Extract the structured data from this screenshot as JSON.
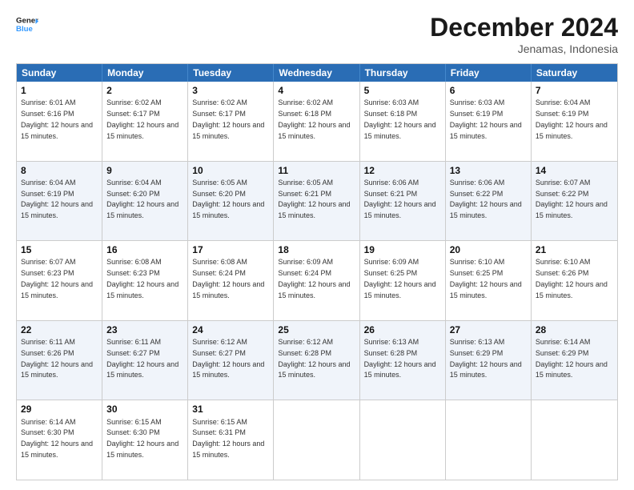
{
  "header": {
    "logo_general": "General",
    "logo_blue": "Blue",
    "month_title": "December 2024",
    "location": "Jenamas, Indonesia"
  },
  "days_of_week": [
    "Sunday",
    "Monday",
    "Tuesday",
    "Wednesday",
    "Thursday",
    "Friday",
    "Saturday"
  ],
  "weeks": [
    [
      {
        "day": 1,
        "sunrise": "6:01 AM",
        "sunset": "6:16 PM",
        "daylight": "12 hours and 15 minutes."
      },
      {
        "day": 2,
        "sunrise": "6:02 AM",
        "sunset": "6:17 PM",
        "daylight": "12 hours and 15 minutes."
      },
      {
        "day": 3,
        "sunrise": "6:02 AM",
        "sunset": "6:17 PM",
        "daylight": "12 hours and 15 minutes."
      },
      {
        "day": 4,
        "sunrise": "6:02 AM",
        "sunset": "6:18 PM",
        "daylight": "12 hours and 15 minutes."
      },
      {
        "day": 5,
        "sunrise": "6:03 AM",
        "sunset": "6:18 PM",
        "daylight": "12 hours and 15 minutes."
      },
      {
        "day": 6,
        "sunrise": "6:03 AM",
        "sunset": "6:19 PM",
        "daylight": "12 hours and 15 minutes."
      },
      {
        "day": 7,
        "sunrise": "6:04 AM",
        "sunset": "6:19 PM",
        "daylight": "12 hours and 15 minutes."
      }
    ],
    [
      {
        "day": 8,
        "sunrise": "6:04 AM",
        "sunset": "6:19 PM",
        "daylight": "12 hours and 15 minutes."
      },
      {
        "day": 9,
        "sunrise": "6:04 AM",
        "sunset": "6:20 PM",
        "daylight": "12 hours and 15 minutes."
      },
      {
        "day": 10,
        "sunrise": "6:05 AM",
        "sunset": "6:20 PM",
        "daylight": "12 hours and 15 minutes."
      },
      {
        "day": 11,
        "sunrise": "6:05 AM",
        "sunset": "6:21 PM",
        "daylight": "12 hours and 15 minutes."
      },
      {
        "day": 12,
        "sunrise": "6:06 AM",
        "sunset": "6:21 PM",
        "daylight": "12 hours and 15 minutes."
      },
      {
        "day": 13,
        "sunrise": "6:06 AM",
        "sunset": "6:22 PM",
        "daylight": "12 hours and 15 minutes."
      },
      {
        "day": 14,
        "sunrise": "6:07 AM",
        "sunset": "6:22 PM",
        "daylight": "12 hours and 15 minutes."
      }
    ],
    [
      {
        "day": 15,
        "sunrise": "6:07 AM",
        "sunset": "6:23 PM",
        "daylight": "12 hours and 15 minutes."
      },
      {
        "day": 16,
        "sunrise": "6:08 AM",
        "sunset": "6:23 PM",
        "daylight": "12 hours and 15 minutes."
      },
      {
        "day": 17,
        "sunrise": "6:08 AM",
        "sunset": "6:24 PM",
        "daylight": "12 hours and 15 minutes."
      },
      {
        "day": 18,
        "sunrise": "6:09 AM",
        "sunset": "6:24 PM",
        "daylight": "12 hours and 15 minutes."
      },
      {
        "day": 19,
        "sunrise": "6:09 AM",
        "sunset": "6:25 PM",
        "daylight": "12 hours and 15 minutes."
      },
      {
        "day": 20,
        "sunrise": "6:10 AM",
        "sunset": "6:25 PM",
        "daylight": "12 hours and 15 minutes."
      },
      {
        "day": 21,
        "sunrise": "6:10 AM",
        "sunset": "6:26 PM",
        "daylight": "12 hours and 15 minutes."
      }
    ],
    [
      {
        "day": 22,
        "sunrise": "6:11 AM",
        "sunset": "6:26 PM",
        "daylight": "12 hours and 15 minutes."
      },
      {
        "day": 23,
        "sunrise": "6:11 AM",
        "sunset": "6:27 PM",
        "daylight": "12 hours and 15 minutes."
      },
      {
        "day": 24,
        "sunrise": "6:12 AM",
        "sunset": "6:27 PM",
        "daylight": "12 hours and 15 minutes."
      },
      {
        "day": 25,
        "sunrise": "6:12 AM",
        "sunset": "6:28 PM",
        "daylight": "12 hours and 15 minutes."
      },
      {
        "day": 26,
        "sunrise": "6:13 AM",
        "sunset": "6:28 PM",
        "daylight": "12 hours and 15 minutes."
      },
      {
        "day": 27,
        "sunrise": "6:13 AM",
        "sunset": "6:29 PM",
        "daylight": "12 hours and 15 minutes."
      },
      {
        "day": 28,
        "sunrise": "6:14 AM",
        "sunset": "6:29 PM",
        "daylight": "12 hours and 15 minutes."
      }
    ],
    [
      {
        "day": 29,
        "sunrise": "6:14 AM",
        "sunset": "6:30 PM",
        "daylight": "12 hours and 15 minutes."
      },
      {
        "day": 30,
        "sunrise": "6:15 AM",
        "sunset": "6:30 PM",
        "daylight": "12 hours and 15 minutes."
      },
      {
        "day": 31,
        "sunrise": "6:15 AM",
        "sunset": "6:31 PM",
        "daylight": "12 hours and 15 minutes."
      },
      null,
      null,
      null,
      null
    ]
  ]
}
